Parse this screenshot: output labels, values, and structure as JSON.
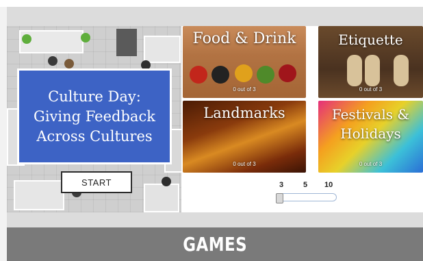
{
  "course": {
    "title_line1": "Culture Day:",
    "title_line2": "Giving Feedback",
    "title_line3": "Across Cultures",
    "start_label": "START"
  },
  "tiles": [
    {
      "title": "Food & Drink",
      "progress": "0 out of 3"
    },
    {
      "title": "Etiquette",
      "progress": "0 out of 3"
    },
    {
      "title": "Landmarks",
      "progress": "0 out of 3"
    },
    {
      "title_line1": "Festivals &",
      "title_line2": "Holidays",
      "progress": "0 out of 3"
    }
  ],
  "pagination": {
    "options": [
      "3",
      "5",
      "10"
    ]
  },
  "footer": {
    "label": "GAMES"
  },
  "colors": {
    "title_card": "#3d63c5",
    "footer_bar": "#7a7a7a"
  }
}
